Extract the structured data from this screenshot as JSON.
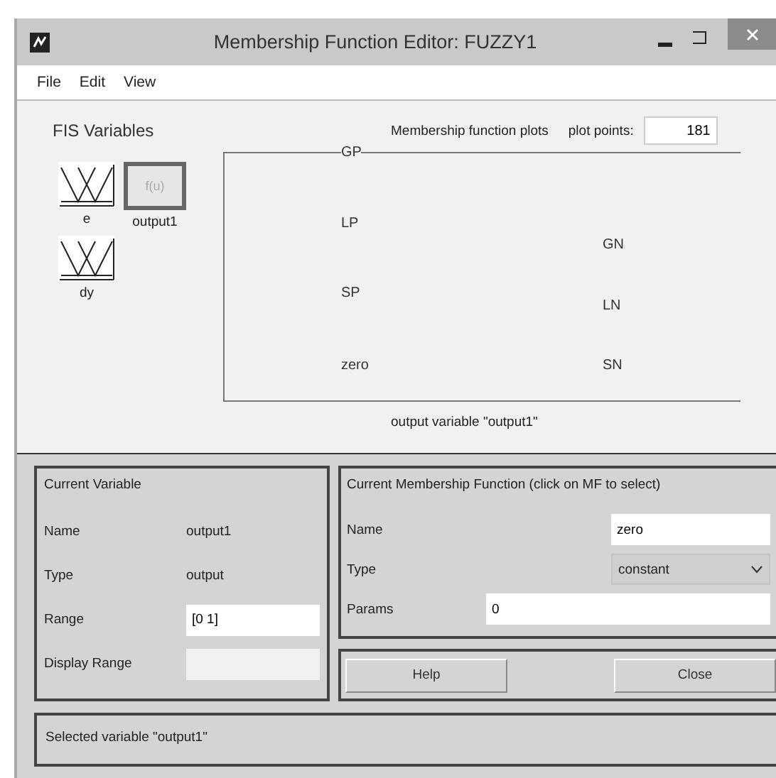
{
  "window": {
    "title": "Membership Function Editor: FUZZY1"
  },
  "menu": [
    "File",
    "Edit",
    "View"
  ],
  "fis_variables": {
    "title": "FIS Variables",
    "items": [
      {
        "label": "e",
        "kind": "input",
        "selected": false
      },
      {
        "label": "output1",
        "kind": "output",
        "icon_text": "f(u)",
        "selected": true
      },
      {
        "label": "dy",
        "kind": "input",
        "selected": false
      }
    ]
  },
  "plot": {
    "title": "Membership function plots",
    "plot_points_label": "plot points:",
    "plot_points": "181",
    "mf_labels_left": [
      "GP",
      "LP",
      "SP",
      "zero"
    ],
    "mf_labels_right": [
      "GN",
      "LN",
      "SN"
    ],
    "caption": "output variable \"output1\""
  },
  "current_variable": {
    "title": "Current Variable",
    "name_label": "Name",
    "name": "output1",
    "type_label": "Type",
    "type": "output",
    "range_label": "Range",
    "range": "[0 1]",
    "display_range_label": "Display Range"
  },
  "current_mf": {
    "title": "Current Membership Function (click on MF to select)",
    "name_label": "Name",
    "name": "zero",
    "type_label": "Type",
    "type": "constant",
    "params_label": "Params",
    "params": "0"
  },
  "buttons": [
    "Help",
    "Close"
  ],
  "status": "Selected variable \"output1\""
}
